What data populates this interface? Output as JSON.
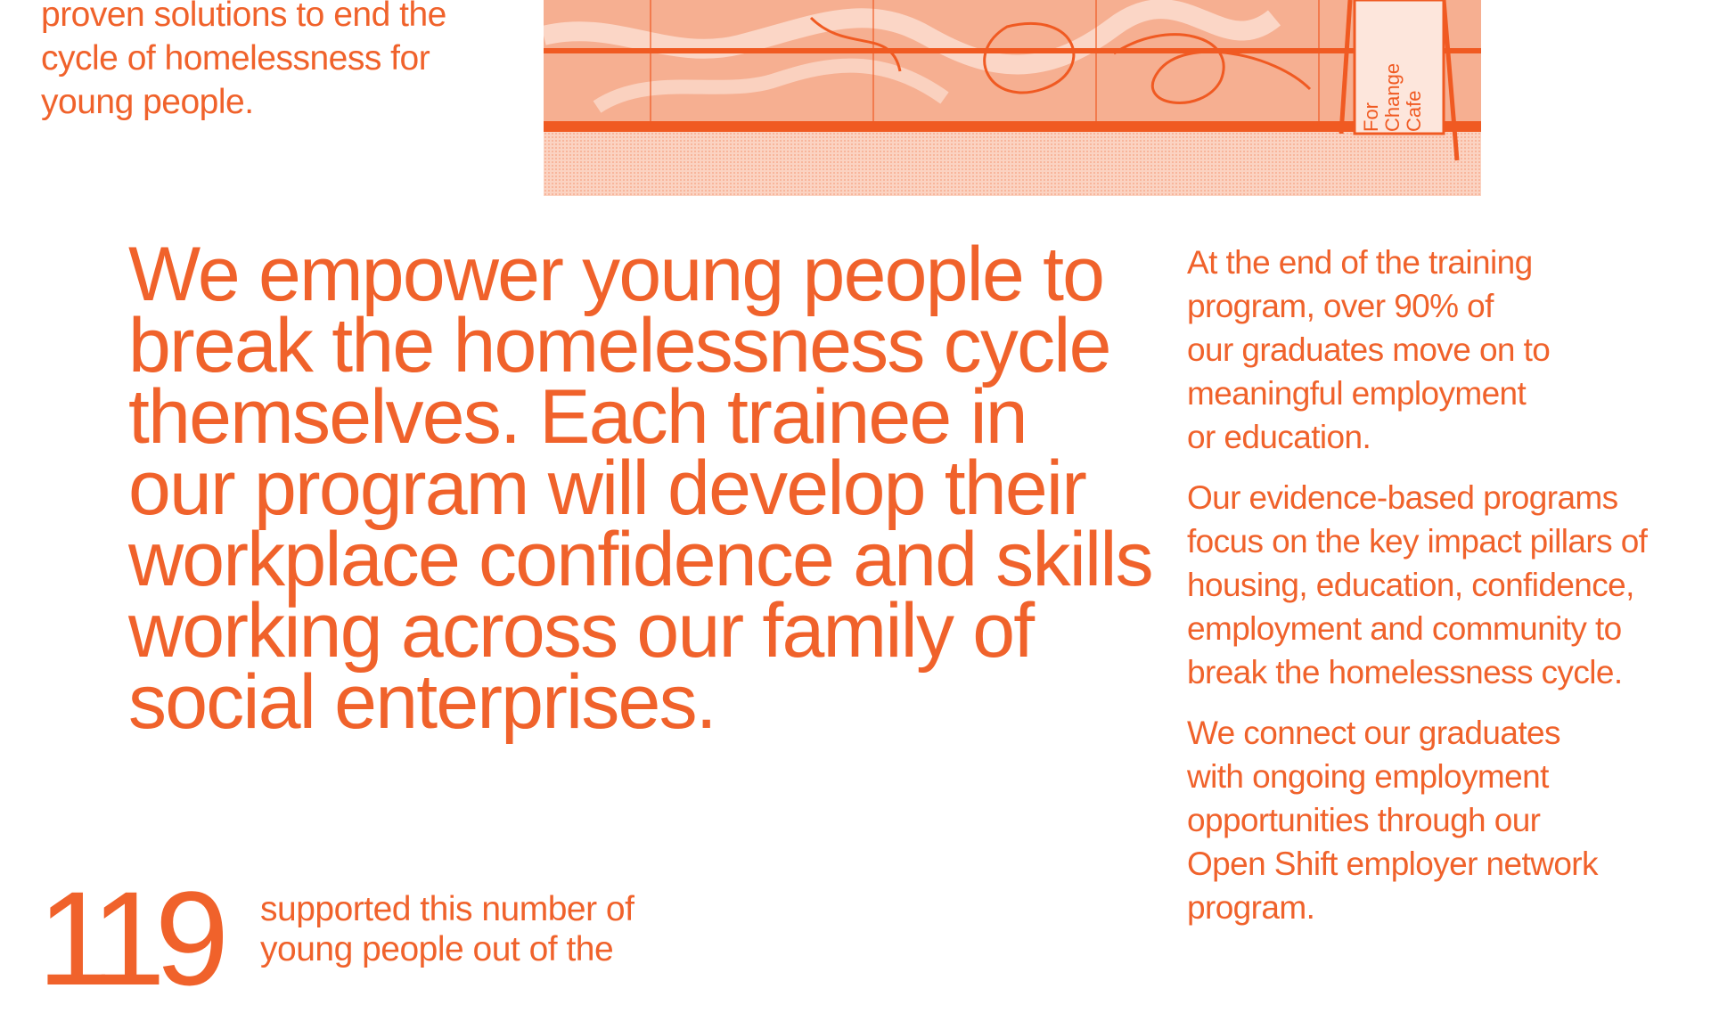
{
  "intro": {
    "lines": [
      "proven solutions to end the",
      "cycle of homelessness for",
      "young people."
    ]
  },
  "photo": {
    "sign_lines": [
      "For",
      "Change",
      "Cafe"
    ]
  },
  "statement": {
    "lines": [
      "We empower young people to",
      "break the homelessness cycle",
      "themselves. Each trainee in",
      "our program will develop their",
      "workplace confidence and skills",
      "working across our family of",
      "social enterprises."
    ]
  },
  "side": {
    "paragraphs": [
      [
        "At the end of the training",
        "program, over 90% of",
        "our graduates move on to",
        "meaningful employment",
        "or education."
      ],
      [
        "Our evidence-based programs",
        "focus on the key impact pillars of",
        "housing, education, confidence,",
        "employment and community to",
        "break the homelessness cycle."
      ],
      [
        "We connect our graduates",
        "with ongoing employment",
        "opportunities through our",
        "Open Shift employer network",
        "program."
      ]
    ]
  },
  "stat": {
    "number": "119",
    "description_lines": [
      "supported this number of",
      "young people out of the"
    ]
  },
  "colors": {
    "accent": "#f0622b",
    "photo_tint": "#fbd0bd",
    "background": "#ffffff"
  }
}
